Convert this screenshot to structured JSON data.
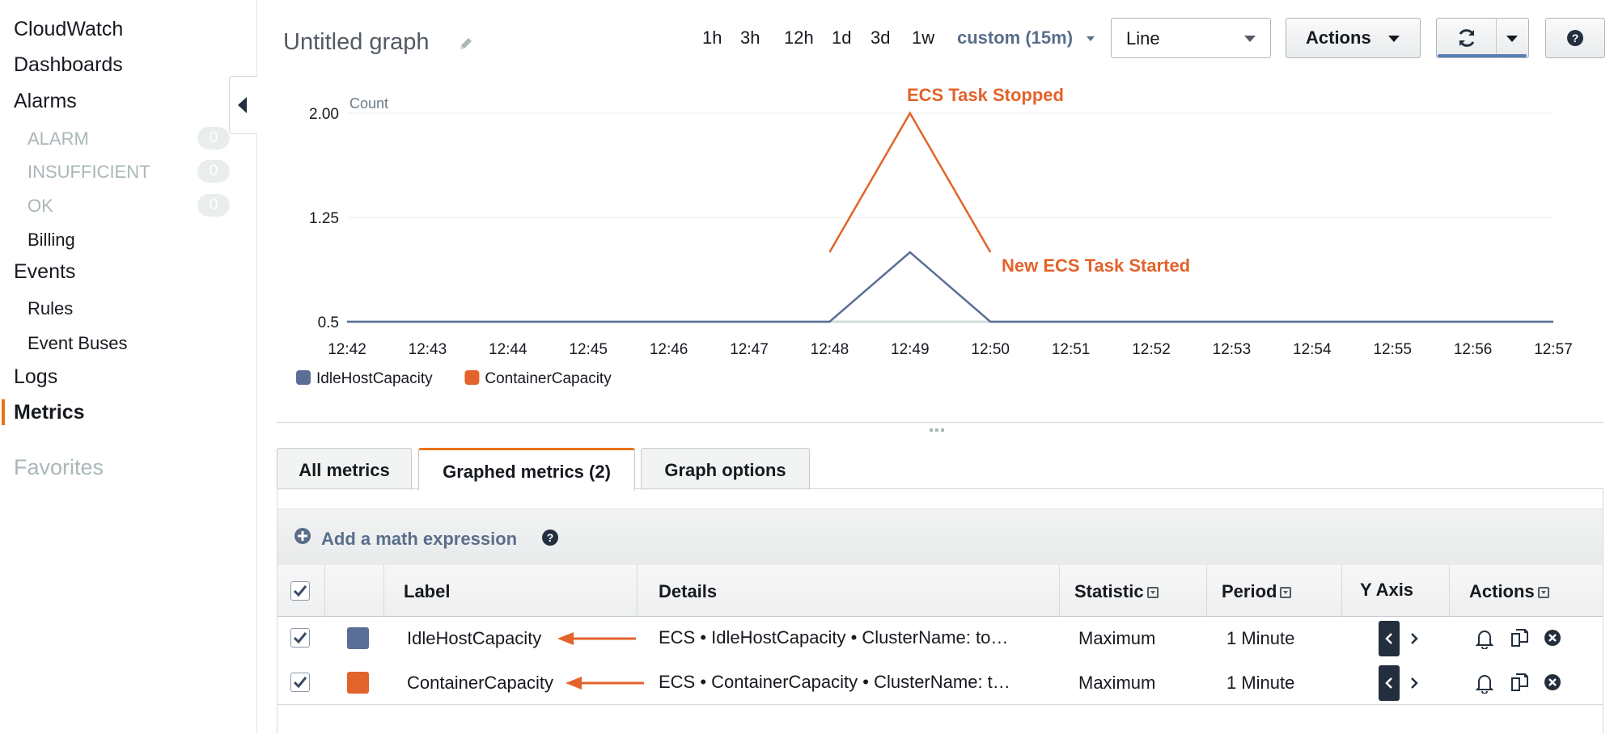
{
  "sidebar": {
    "cloudwatch": "CloudWatch",
    "dashboards": "Dashboards",
    "alarms": "Alarms",
    "alarm_states": [
      {
        "label": "ALARM",
        "count": "0"
      },
      {
        "label": "INSUFFICIENT",
        "count": "0"
      },
      {
        "label": "OK",
        "count": "0"
      }
    ],
    "billing": "Billing",
    "events": "Events",
    "rules": "Rules",
    "event_buses": "Event Buses",
    "logs": "Logs",
    "metrics": "Metrics",
    "favorites": "Favorites"
  },
  "header": {
    "title": "Untitled graph",
    "ranges": [
      "1h",
      "3h",
      "12h",
      "1d",
      "3d",
      "1w"
    ],
    "custom_range": "custom (15m)",
    "graph_type": "Line",
    "actions_label": "Actions"
  },
  "chart_data": {
    "type": "line",
    "ylabel": "Count",
    "y_ticks": [
      "2.00",
      "1.25",
      "0.5"
    ],
    "ylim": [
      0.5,
      2.0
    ],
    "x": [
      "12:42",
      "12:43",
      "12:44",
      "12:45",
      "12:46",
      "12:47",
      "12:48",
      "12:49",
      "12:50",
      "12:51",
      "12:52",
      "12:53",
      "12:54",
      "12:55",
      "12:56",
      "12:57"
    ],
    "series": [
      {
        "name": "IdleHostCapacity",
        "color": "#5a6e96",
        "points": [
          [
            "12:42",
            0.5
          ],
          [
            "12:43",
            0.5
          ],
          [
            "12:44",
            0.5
          ],
          [
            "12:45",
            0.5
          ],
          [
            "12:46",
            0.5
          ],
          [
            "12:47",
            0.5
          ],
          [
            "12:48",
            0.5
          ],
          [
            "12:49",
            1.0
          ],
          [
            "12:50",
            0.5
          ],
          [
            "12:51",
            0.5
          ],
          [
            "12:52",
            0.5
          ],
          [
            "12:53",
            0.5
          ],
          [
            "12:54",
            0.5
          ],
          [
            "12:55",
            0.5
          ],
          [
            "12:56",
            0.5
          ],
          [
            "12:57",
            0.5
          ]
        ]
      },
      {
        "name": "ContainerCapacity",
        "color": "#e2632b",
        "points": [
          [
            "12:48",
            1.0
          ],
          [
            "12:49",
            2.0
          ],
          [
            "12:50",
            1.0
          ]
        ]
      }
    ],
    "annotations": [
      {
        "text": "ECS Task Stopped",
        "color": "#e2632b"
      },
      {
        "text": "New ECS Task Started",
        "color": "#e2632b"
      }
    ],
    "grid": true,
    "legend": "bottom-left"
  },
  "tabs": [
    "All metrics",
    "Graphed metrics (2)",
    "Graph options"
  ],
  "math_expression_label": "Add a math expression",
  "table": {
    "headers": {
      "label": "Label",
      "details": "Details",
      "statistic": "Statistic",
      "period": "Period",
      "y_axis": "Y Axis",
      "actions": "Actions"
    },
    "rows": [
      {
        "color": "#5a6e96",
        "label": "IdleHostCapacity",
        "details": "ECS • IdleHostCapacity • ClusterName: to…",
        "statistic": "Maximum",
        "period": "1 Minute",
        "checked": true
      },
      {
        "color": "#e2632b",
        "label": "ContainerCapacity",
        "details": "ECS • ContainerCapacity • ClusterName: t…",
        "statistic": "Maximum",
        "period": "1 Minute",
        "checked": true
      }
    ]
  }
}
